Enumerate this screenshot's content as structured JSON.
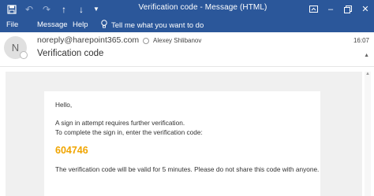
{
  "titlebar": {
    "title": "Verification code  -  Message (HTML)",
    "qat": [
      "save-icon",
      "undo-icon",
      "redo-icon",
      "up-arrow-icon",
      "down-arrow-icon",
      "chevron-down-icon"
    ],
    "window_controls": [
      "ribbon-options-icon",
      "minimize-icon",
      "restore-icon",
      "close-icon"
    ],
    "accent": "#2b579a"
  },
  "ribbon": {
    "tabs": [
      "File",
      "Message",
      "Help"
    ],
    "tell_me": "Tell me what you want to do"
  },
  "message": {
    "avatar_initial": "N",
    "sender": "noreply@harepoint365.com",
    "recipient": "Alexey Shlibanov",
    "subject": "Verification code",
    "time": "16:07"
  },
  "body": {
    "greeting": "Hello,",
    "line1": "A sign in attempt requires further verification.",
    "line2": "To complete the sign in, enter the verification code:",
    "code": "604746",
    "code_color": "#f0a500",
    "line3": "The verification code will be valid for 5 minutes. Please do not share this code with anyone."
  }
}
